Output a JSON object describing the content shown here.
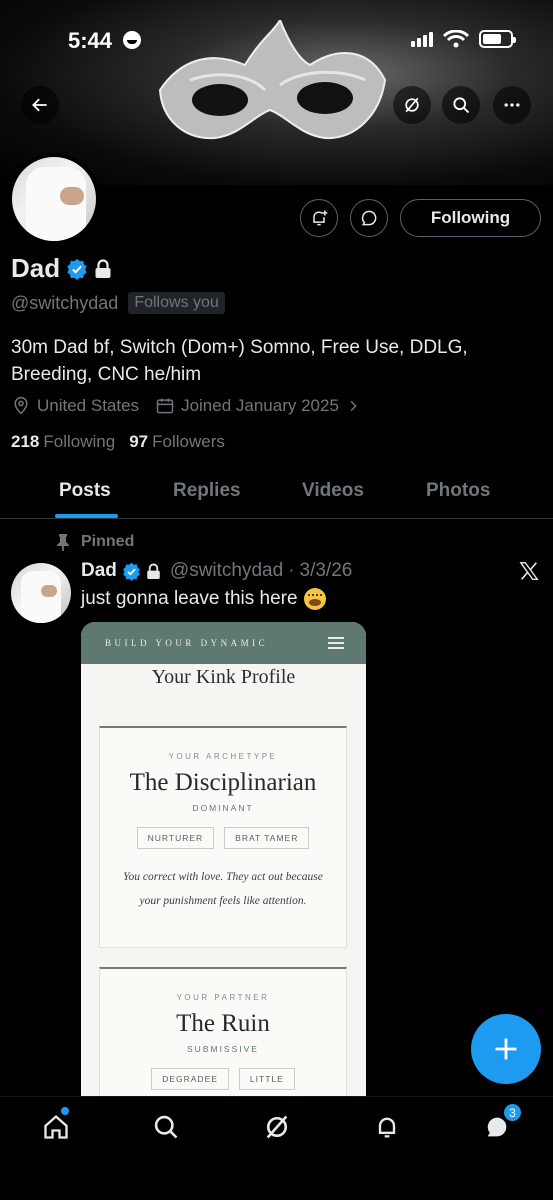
{
  "status_bar": {
    "time": "5:44"
  },
  "profile": {
    "display_name": "Dad",
    "handle": "@switchydad",
    "follows_you": "Follows you",
    "bio_line1": "30m Dad bf, Switch (Dom+) Somno, Free Use, DDLG,",
    "bio_line2": "Breeding, CNC he/him",
    "location": "United States",
    "joined": "Joined January 2025",
    "following_count": "218",
    "following_label": "Following",
    "followers_count": "97",
    "followers_label": "Followers",
    "follow_button": "Following"
  },
  "tabs": [
    "Posts",
    "Replies",
    "Videos",
    "Photos"
  ],
  "post": {
    "pinned_label": "Pinned",
    "author_name": "Dad",
    "author_handle": "@switchydad",
    "separator": "·",
    "date": "3/3/26",
    "text": "just gonna leave this here"
  },
  "media": {
    "brand": "BUILD YOUR DYNAMIC",
    "title": "Your Kink Profile",
    "card1": {
      "caption": "YOUR ARCHETYPE",
      "title": "The Disciplinarian",
      "class": "DOMINANT",
      "chips": [
        "NURTURER",
        "BRAT TAMER"
      ],
      "desc_line1": "You correct with love. They act out because",
      "desc_line2": "your punishment feels like attention."
    },
    "card2": {
      "caption": "YOUR PARTNER",
      "title": "The Ruin",
      "class": "SUBMISSIVE",
      "chips": [
        "DEGRADEE",
        "LITTLE"
      ]
    }
  },
  "bottom_nav": {
    "messages_badge": "3"
  },
  "colors": {
    "accent": "#1d9bf0",
    "muted": "#71767b",
    "text": "#e7e9ea",
    "media_header": "#5e7872"
  }
}
